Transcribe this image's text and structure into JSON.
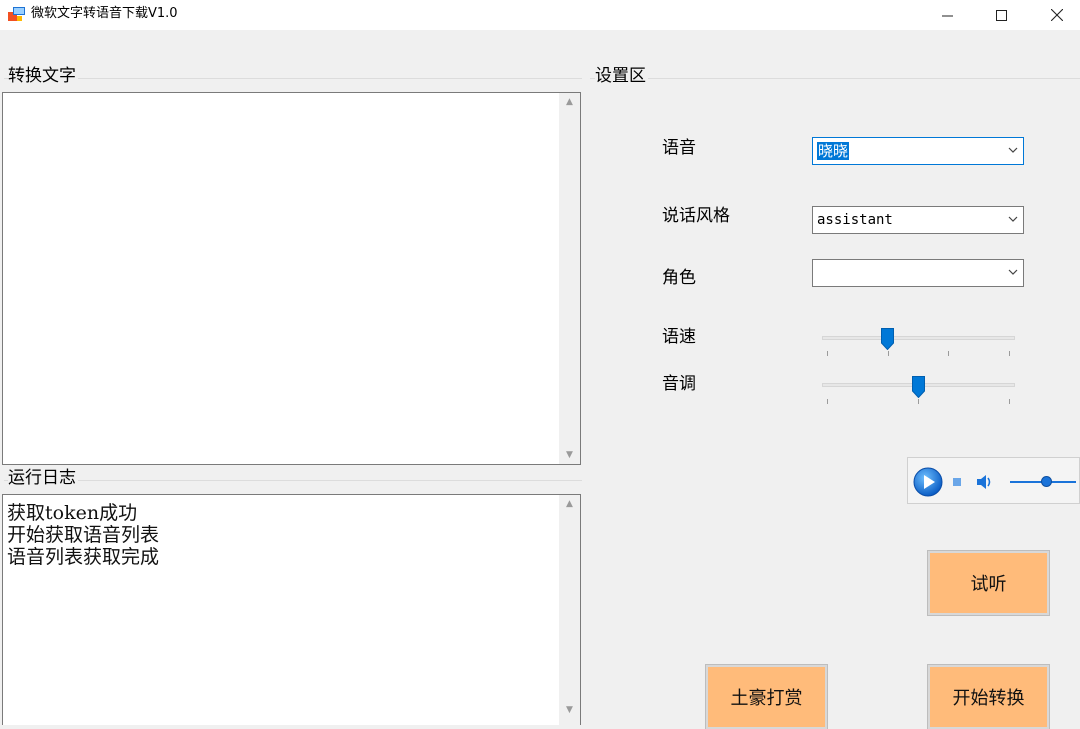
{
  "window": {
    "title": "微软文字转语音下载V1.0",
    "controls": {
      "minimize": "—",
      "maximize": "☐",
      "close": "✕"
    }
  },
  "text_group": {
    "title": "转换文字",
    "content": ""
  },
  "log_group": {
    "title": "运行日志",
    "lines": [
      "获取token成功",
      "开始获取语音列表",
      "语音列表获取完成"
    ]
  },
  "settings": {
    "title": "设置区",
    "voice": {
      "label": "语音",
      "value": "晓晓"
    },
    "style": {
      "label": "说话风格",
      "value": "assistant"
    },
    "role": {
      "label": "角色",
      "value": ""
    },
    "speed": {
      "label": "语速",
      "level": 0.35
    },
    "pitch": {
      "label": "音调",
      "level": 0.5
    }
  },
  "player": {
    "icons": [
      "play-icon",
      "stop-icon",
      "volume-icon"
    ],
    "volume_level": 0.6
  },
  "buttons": {
    "preview": "试听",
    "tip": "土豪打赏",
    "convert": "开始转换"
  },
  "colors": {
    "button_fill": "#ffbb7a",
    "accent": "#0078d7",
    "background": "#f0f0f0"
  }
}
